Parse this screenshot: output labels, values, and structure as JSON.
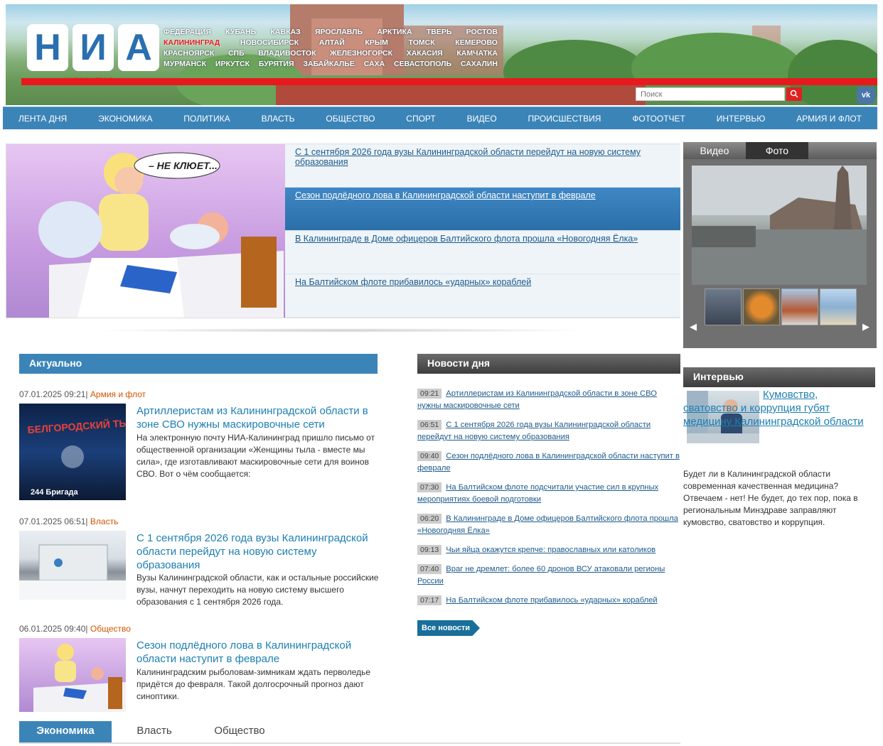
{
  "header": {
    "logo_letters": [
      "Н",
      "И",
      "А"
    ],
    "region_label": "КАЛИНИНГРАД",
    "regions": [
      [
        "ФЕДЕРАЦИЯ",
        "КУБАНЬ",
        "КАВКАЗ",
        "ЯРОСЛАВЛЬ",
        "АРКТИКА",
        "ТВЕРЬ",
        "РОСТОВ"
      ],
      [
        "КАЛИНИНГРАД",
        "НОВОСИБИРСК",
        "АЛТАЙ",
        "КРЫМ",
        "ТОМСК",
        "КЕМЕРОВО"
      ],
      [
        "КРАСНОЯРСК",
        "СПБ",
        "ВЛАДИВОСТОК",
        "ЖЕЛЕЗНОГОРСК",
        "ХАКАСИЯ",
        "КАМЧАТКА"
      ],
      [
        "МУРМАНСК",
        "ИРКУТСК",
        "БУРЯТИЯ",
        "ЗАБАЙКАЛЬЕ",
        "САХА",
        "СЕВАСТОПОЛЬ",
        "САХАЛИН"
      ]
    ],
    "active_region": "КАЛИНИНГРАД",
    "search_placeholder": "Поиск",
    "vk_label": "vk"
  },
  "nav": [
    "ЛЕНТА ДНЯ",
    "ЭКОНОМИКА",
    "ПОЛИТИКА",
    "ВЛАСТЬ",
    "ОБЩЕСТВО",
    "СПОРТ",
    "ВИДЕО",
    "ПРОИСШЕСТВИЯ",
    "ФОТООТЧЕТ",
    "ИНТЕРВЬЮ",
    "АРМИЯ И ФЛОТ"
  ],
  "slider": {
    "image_caption": "– НЕ КЛЮЕТ...",
    "items": [
      "С 1 сентября 2026 года вузы Калининградской области перейдут на новую систему образования",
      "Сезон подлёдного лова в Калининградской области наступит в феврале",
      "В Калининграде в Доме офицеров Балтийского флота прошла «Новогодняя Ёлка»",
      "На Балтийском флоте прибавилось «ударных» кораблей"
    ]
  },
  "media": {
    "tabs": [
      "Видео",
      "Фото"
    ],
    "active_tab": "Фото"
  },
  "aktual": {
    "heading": "Актуально",
    "articles": [
      {
        "date": "07.01.2025 09:21",
        "sep": "|",
        "category": "Армия и флот",
        "title": "Артиллеристам из Калининградской области в зоне СВО нужны маскировочные сети",
        "desc": "На электронную почту НИА-Калининград пришло письмо от общественной организации «Женщины тыла - вместе мы сила», где изготавливают маскировочные сети для воинов СВО. Вот о чём сообщается:"
      },
      {
        "date": "07.01.2025 06:51",
        "sep": "|",
        "category": "Власть",
        "title": "С 1 сентября 2026 года вузы Калининградской области перейдут на новую систему образования",
        "desc": "Вузы Калининградской области, как и остальные российские вузы, начнут переходить на новую систему высшего образования с 1 сентября 2026 года."
      },
      {
        "date": "06.01.2025 09:40",
        "sep": "|",
        "category": "Общество",
        "title": "Сезон подлёдного лова в Калининградской области наступит в феврале",
        "desc": "Калининградским рыболовам-зимникам ждать перволедье придётся до февраля. Такой долгосрочный прогноз дают синоптики."
      }
    ],
    "thumb_text_1": "БЕЛГОРОДСКИЙ ТЫЛ",
    "thumb_text_2": "244 Бригада"
  },
  "news_day": {
    "heading": "Новости дня",
    "items": [
      {
        "time": "09:21",
        "text": "Артиллеристам из Калининградской области в зоне СВО нужны маскировочные сети"
      },
      {
        "time": "06:51",
        "text": "С 1 сентября 2026 года вузы Калининградской области перейдут на новую систему образования"
      },
      {
        "time": "09:40",
        "text": "Сезон подлёдного лова в Калининградской области наступит в феврале"
      },
      {
        "time": "07:30",
        "text": "На Балтийском флоте подсчитали участие сил в крупных мероприятиях боевой подготовки"
      },
      {
        "time": "06:20",
        "text": "В Калининграде в Доме офицеров Балтийского флота прошла «Новогодняя Ёлка»"
      },
      {
        "time": "09:13",
        "text": "Чьи яйца окажутся крепче: православных или католиков"
      },
      {
        "time": "07:40",
        "text": "Враг не дремлет: более 60 дронов ВСУ атаковали регионы России"
      },
      {
        "time": "07:17",
        "text": "На Балтийском флоте прибавилось «ударных» кораблей"
      }
    ],
    "all_news": "Все новости"
  },
  "interview": {
    "heading": "Интервью",
    "title": "Кумовство, сватовство и коррупция губят медицину Калининградской области",
    "desc": "Будет ли в Калининградской области современная качественная медицина? Отвечаем - нет! Не будет, до тех пор, пока в региональным Минздраве заправляют кумовство, сватовство и коррупция."
  },
  "bottom_tabs": [
    "Экономика",
    "Власть",
    "Общество"
  ],
  "colors": {
    "accent": "#3b84b8",
    "brand_red": "#e8191d",
    "link": "#1d7fb3",
    "category": "#d35400"
  }
}
